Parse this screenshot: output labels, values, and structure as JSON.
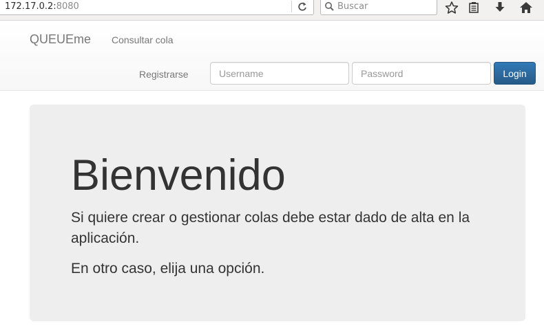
{
  "browser": {
    "url_host": "172.17.0.2:",
    "url_port": "8080",
    "search_placeholder": "Buscar"
  },
  "navbar": {
    "brand": "QUEUEme",
    "link_consultar": "Consultar cola",
    "link_registrarse": "Registrarse",
    "username_placeholder": "Username",
    "password_placeholder": "Password",
    "login_label": "Login"
  },
  "jumbotron": {
    "title": "Bienvenido",
    "paragraph1": "Si quiere crear o gestionar colas debe estar dado de alta en la aplicación.",
    "paragraph2": "En otro caso, elija una opción."
  },
  "colors": {
    "primary_button": "#337ab7",
    "jumbotron_bg": "#eeeeee",
    "nav_text": "#777777"
  },
  "icons": [
    "reload-icon",
    "search-icon",
    "bookmark-star-icon",
    "reading-list-icon",
    "download-icon",
    "home-icon"
  ]
}
